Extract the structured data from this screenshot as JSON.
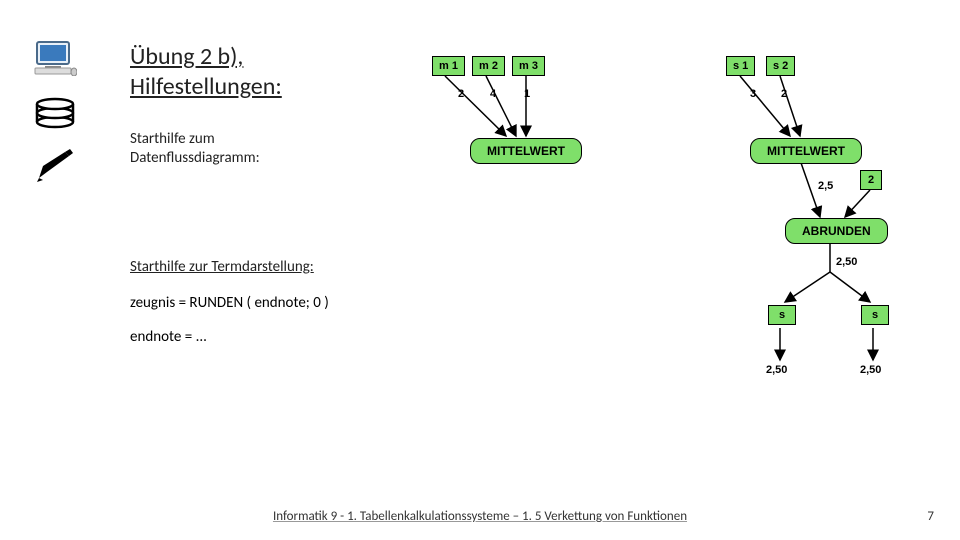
{
  "title_l1": "Übung 2 b),",
  "title_l2": "Hilfestellungen:",
  "starthilfe1_l1": "Starthilfe zum",
  "starthilfe1_l2": "Datenflussdiagramm:",
  "starthilfe2": "Starthilfe zur Termdarstellung:",
  "term1": "zeugnis = RUNDEN ( endnote; 0 )",
  "term2": "endnote = ...",
  "footer": "Informatik 9 - 1. Tabellenkalkulationssysteme – 1. 5 Verkettung von Funktionen",
  "pagenum": "7",
  "diagram": {
    "m1": "m 1",
    "m2": "m 2",
    "m3": "m 3",
    "s1": "s 1",
    "s2": "s 2",
    "l2": "2",
    "l4": "4",
    "l1": "1",
    "l3": "3",
    "l2b": "2",
    "mittelwert": "MITTELWERT",
    "abrunden": "ABRUNDEN",
    "v2_5": "2,5",
    "v2_50": "2,50",
    "box2": "2",
    "box_s_l": "s",
    "box_s_r": "s",
    "out_l": "2,50",
    "out_r": "2,50"
  },
  "chart_data": {
    "type": "table",
    "title": "Datenflussdiagramm (data-flow diagram) – Übung 2 b)",
    "nodes": [
      {
        "id": "m1",
        "label": "m 1",
        "kind": "input"
      },
      {
        "id": "m2",
        "label": "m 2",
        "kind": "input"
      },
      {
        "id": "m3",
        "label": "m 3",
        "kind": "input"
      },
      {
        "id": "s1",
        "label": "s 1",
        "kind": "input"
      },
      {
        "id": "s2",
        "label": "s 2",
        "kind": "input"
      },
      {
        "id": "mw_m",
        "label": "MITTELWERT",
        "kind": "function"
      },
      {
        "id": "mw_s",
        "label": "MITTELWERT",
        "kind": "function"
      },
      {
        "id": "const2",
        "label": "2",
        "kind": "constant"
      },
      {
        "id": "abrunden",
        "label": "ABRUNDEN",
        "kind": "function"
      },
      {
        "id": "sL",
        "label": "s",
        "kind": "variable"
      },
      {
        "id": "sR",
        "label": "s",
        "kind": "variable"
      }
    ],
    "edges": [
      {
        "from": "m1",
        "to": "mw_m",
        "label": "2"
      },
      {
        "from": "m2",
        "to": "mw_m",
        "label": "4"
      },
      {
        "from": "m3",
        "to": "mw_m",
        "label": "1"
      },
      {
        "from": "s1",
        "to": "mw_s",
        "label": "3"
      },
      {
        "from": "s2",
        "to": "mw_s",
        "label": "2"
      },
      {
        "from": "mw_s",
        "to": "abrunden",
        "label": "2,5"
      },
      {
        "from": "const2",
        "to": "abrunden"
      },
      {
        "from": "abrunden",
        "to": "sL",
        "label": "2,50"
      },
      {
        "from": "abrunden",
        "to": "sR",
        "label": "2,50"
      },
      {
        "from": "sL",
        "label": "2,50"
      },
      {
        "from": "sR",
        "label": "2,50"
      }
    ]
  }
}
